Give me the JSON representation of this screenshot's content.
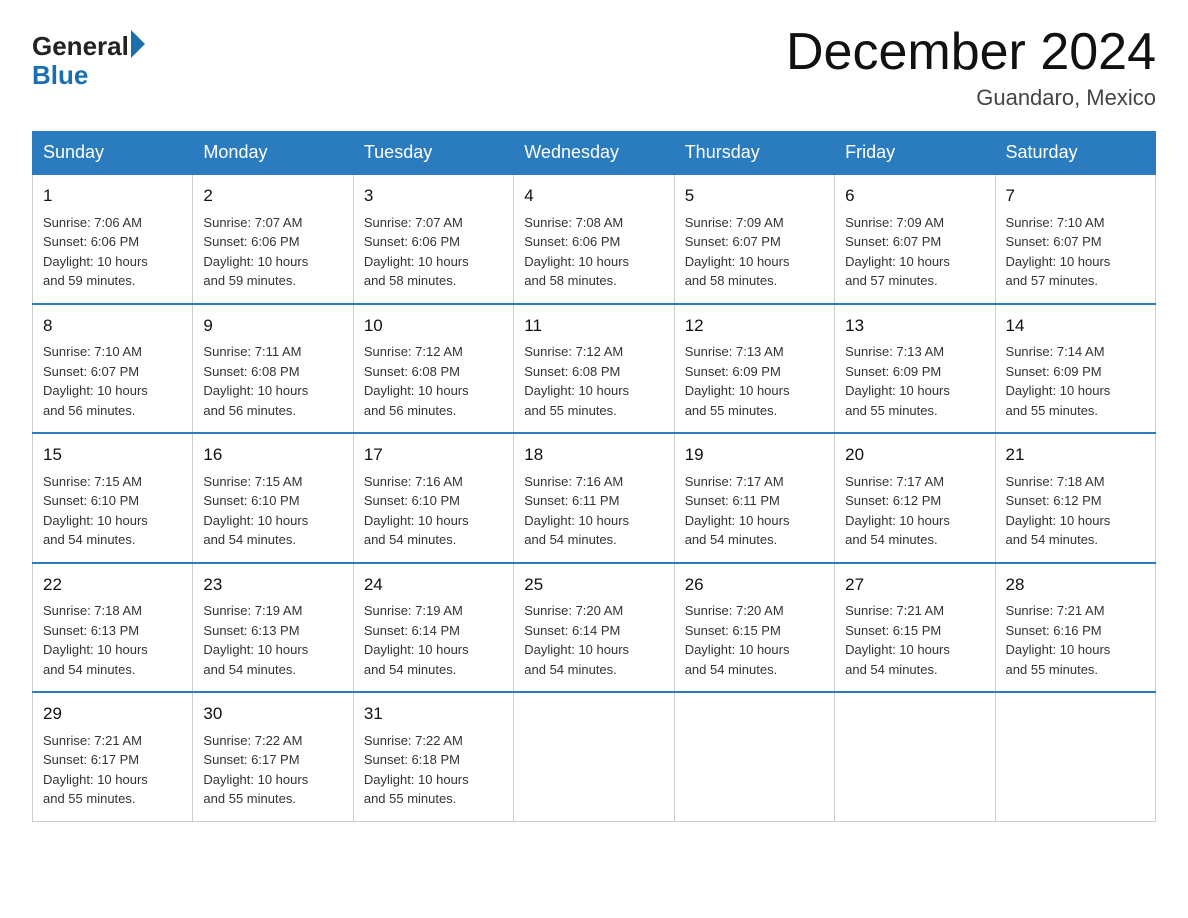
{
  "header": {
    "logo_general": "General",
    "logo_blue": "Blue",
    "month_title": "December 2024",
    "location": "Guandaro, Mexico"
  },
  "days_of_week": [
    "Sunday",
    "Monday",
    "Tuesday",
    "Wednesday",
    "Thursday",
    "Friday",
    "Saturday"
  ],
  "weeks": [
    [
      {
        "day": "1",
        "sunrise": "7:06 AM",
        "sunset": "6:06 PM",
        "daylight": "10 hours and 59 minutes."
      },
      {
        "day": "2",
        "sunrise": "7:07 AM",
        "sunset": "6:06 PM",
        "daylight": "10 hours and 59 minutes."
      },
      {
        "day": "3",
        "sunrise": "7:07 AM",
        "sunset": "6:06 PM",
        "daylight": "10 hours and 58 minutes."
      },
      {
        "day": "4",
        "sunrise": "7:08 AM",
        "sunset": "6:06 PM",
        "daylight": "10 hours and 58 minutes."
      },
      {
        "day": "5",
        "sunrise": "7:09 AM",
        "sunset": "6:07 PM",
        "daylight": "10 hours and 58 minutes."
      },
      {
        "day": "6",
        "sunrise": "7:09 AM",
        "sunset": "6:07 PM",
        "daylight": "10 hours and 57 minutes."
      },
      {
        "day": "7",
        "sunrise": "7:10 AM",
        "sunset": "6:07 PM",
        "daylight": "10 hours and 57 minutes."
      }
    ],
    [
      {
        "day": "8",
        "sunrise": "7:10 AM",
        "sunset": "6:07 PM",
        "daylight": "10 hours and 56 minutes."
      },
      {
        "day": "9",
        "sunrise": "7:11 AM",
        "sunset": "6:08 PM",
        "daylight": "10 hours and 56 minutes."
      },
      {
        "day": "10",
        "sunrise": "7:12 AM",
        "sunset": "6:08 PM",
        "daylight": "10 hours and 56 minutes."
      },
      {
        "day": "11",
        "sunrise": "7:12 AM",
        "sunset": "6:08 PM",
        "daylight": "10 hours and 55 minutes."
      },
      {
        "day": "12",
        "sunrise": "7:13 AM",
        "sunset": "6:09 PM",
        "daylight": "10 hours and 55 minutes."
      },
      {
        "day": "13",
        "sunrise": "7:13 AM",
        "sunset": "6:09 PM",
        "daylight": "10 hours and 55 minutes."
      },
      {
        "day": "14",
        "sunrise": "7:14 AM",
        "sunset": "6:09 PM",
        "daylight": "10 hours and 55 minutes."
      }
    ],
    [
      {
        "day": "15",
        "sunrise": "7:15 AM",
        "sunset": "6:10 PM",
        "daylight": "10 hours and 54 minutes."
      },
      {
        "day": "16",
        "sunrise": "7:15 AM",
        "sunset": "6:10 PM",
        "daylight": "10 hours and 54 minutes."
      },
      {
        "day": "17",
        "sunrise": "7:16 AM",
        "sunset": "6:10 PM",
        "daylight": "10 hours and 54 minutes."
      },
      {
        "day": "18",
        "sunrise": "7:16 AM",
        "sunset": "6:11 PM",
        "daylight": "10 hours and 54 minutes."
      },
      {
        "day": "19",
        "sunrise": "7:17 AM",
        "sunset": "6:11 PM",
        "daylight": "10 hours and 54 minutes."
      },
      {
        "day": "20",
        "sunrise": "7:17 AM",
        "sunset": "6:12 PM",
        "daylight": "10 hours and 54 minutes."
      },
      {
        "day": "21",
        "sunrise": "7:18 AM",
        "sunset": "6:12 PM",
        "daylight": "10 hours and 54 minutes."
      }
    ],
    [
      {
        "day": "22",
        "sunrise": "7:18 AM",
        "sunset": "6:13 PM",
        "daylight": "10 hours and 54 minutes."
      },
      {
        "day": "23",
        "sunrise": "7:19 AM",
        "sunset": "6:13 PM",
        "daylight": "10 hours and 54 minutes."
      },
      {
        "day": "24",
        "sunrise": "7:19 AM",
        "sunset": "6:14 PM",
        "daylight": "10 hours and 54 minutes."
      },
      {
        "day": "25",
        "sunrise": "7:20 AM",
        "sunset": "6:14 PM",
        "daylight": "10 hours and 54 minutes."
      },
      {
        "day": "26",
        "sunrise": "7:20 AM",
        "sunset": "6:15 PM",
        "daylight": "10 hours and 54 minutes."
      },
      {
        "day": "27",
        "sunrise": "7:21 AM",
        "sunset": "6:15 PM",
        "daylight": "10 hours and 54 minutes."
      },
      {
        "day": "28",
        "sunrise": "7:21 AM",
        "sunset": "6:16 PM",
        "daylight": "10 hours and 55 minutes."
      }
    ],
    [
      {
        "day": "29",
        "sunrise": "7:21 AM",
        "sunset": "6:17 PM",
        "daylight": "10 hours and 55 minutes."
      },
      {
        "day": "30",
        "sunrise": "7:22 AM",
        "sunset": "6:17 PM",
        "daylight": "10 hours and 55 minutes."
      },
      {
        "day": "31",
        "sunrise": "7:22 AM",
        "sunset": "6:18 PM",
        "daylight": "10 hours and 55 minutes."
      },
      null,
      null,
      null,
      null
    ]
  ],
  "labels": {
    "sunrise": "Sunrise:",
    "sunset": "Sunset:",
    "daylight": "Daylight:"
  }
}
